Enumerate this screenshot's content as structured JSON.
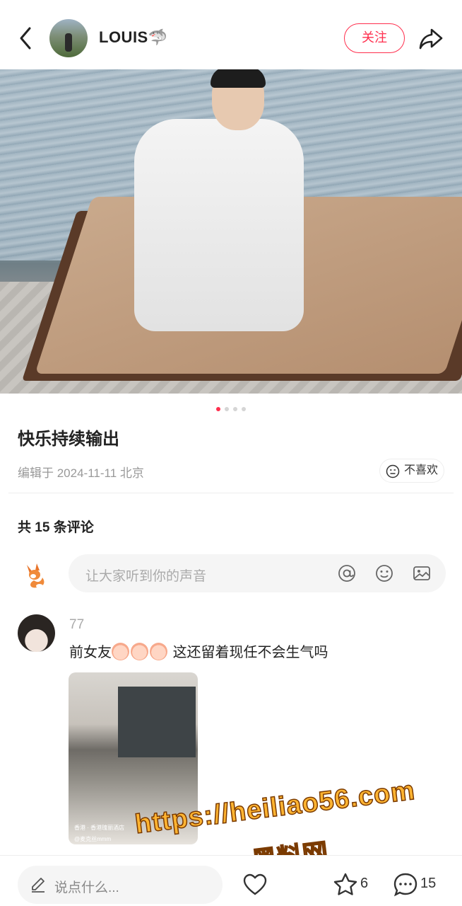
{
  "header": {
    "username": "LOUIS🦈",
    "follow_label": "关注"
  },
  "post": {
    "title": "快乐持续输出",
    "meta": "编辑于 2024-11-11 北京",
    "dislike_label": "不喜欢",
    "image_index": 1,
    "image_total": 4
  },
  "comments": {
    "count_label": "共 15 条评论",
    "input_placeholder": "让大家听到你的声音",
    "items": [
      {
        "name": "77",
        "text": "这还留着现任不会生气吗",
        "text_prefix": "前女友",
        "image_location": "香港 · 香港瑰丽酒店",
        "image_user": "@麦克丝mmm"
      }
    ]
  },
  "watermark": {
    "line1": "https://heiliao56.com",
    "line2": "黑料网"
  },
  "bottom_bar": {
    "say_placeholder": "说点什么...",
    "collect_count": "6",
    "comment_count": "15"
  },
  "colors": {
    "accent": "#ff2e4d",
    "watermark": "#ffb431"
  }
}
